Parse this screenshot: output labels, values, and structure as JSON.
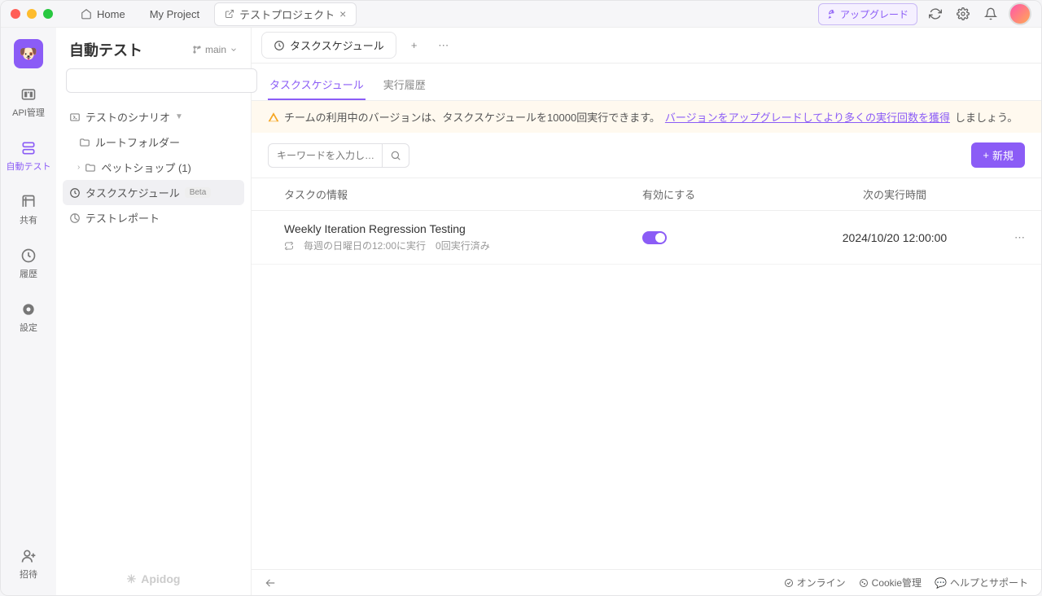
{
  "titlebar": {
    "tabs": [
      {
        "label": "Home"
      },
      {
        "label": "My Project"
      },
      {
        "label": "テストプロジェクト",
        "active": true
      }
    ],
    "upgrade": "アップグレード"
  },
  "rail": {
    "items": [
      {
        "label": "API管理"
      },
      {
        "label": "自動テスト",
        "active": true
      },
      {
        "label": "共有"
      },
      {
        "label": "履歴"
      },
      {
        "label": "設定"
      }
    ],
    "invite": "招待"
  },
  "sidebar": {
    "title": "自動テスト",
    "branch": "main",
    "search_placeholder": "",
    "scenarios_label": "テストのシナリオ",
    "root_folder": "ルートフォルダー",
    "folders": [
      {
        "label": "ペットショップ (1)"
      }
    ],
    "schedule_label": "タスクスケジュール",
    "schedule_badge": "Beta",
    "report_label": "テストレポート",
    "brand": "Apidog"
  },
  "page": {
    "tab_label": "タスクスケジュール",
    "subtabs": {
      "schedule": "タスクスケジュール",
      "history": "実行履歴"
    },
    "banner": {
      "text": "チームの利用中のバージョンは、タスクスケジュールを10000回実行できます。",
      "link": "バージョンをアップグレードしてより多くの実行回数を獲得",
      "suffix": "しましょう。"
    },
    "keyword_placeholder": "キーワードを入力し…",
    "new_button": "新規",
    "columns": {
      "info": "タスクの情報",
      "enable": "有効にする",
      "next": "次の実行時間"
    },
    "rows": [
      {
        "name": "Weekly Iteration Regression Testing",
        "schedule": "毎週の日曜日の12:00に実行",
        "runs": "0回実行済み",
        "enabled": true,
        "next": "2024/10/20 12:00:00"
      }
    ]
  },
  "statusbar": {
    "online": "オンライン",
    "cookie": "Cookie管理",
    "help": "ヘルプとサポート"
  }
}
